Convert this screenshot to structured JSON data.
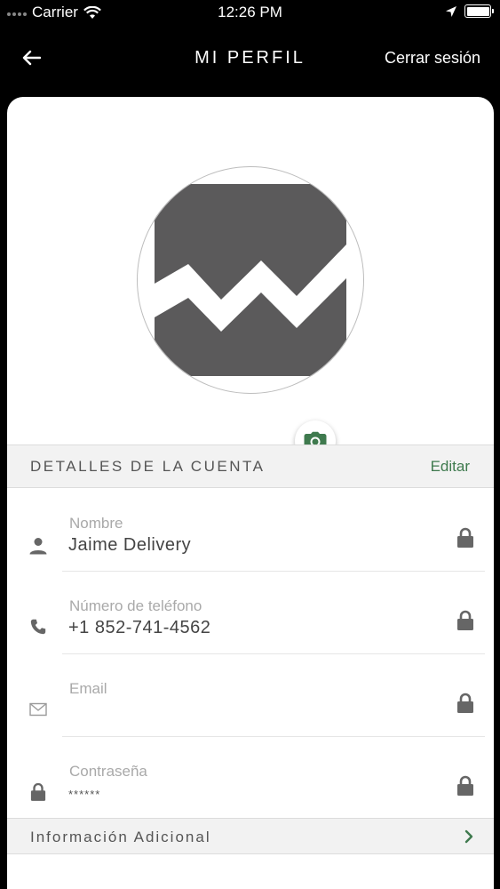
{
  "status": {
    "carrier": "Carrier",
    "time": "12:26 PM"
  },
  "nav": {
    "title": "MI PERFIL",
    "logout": "Cerrar sesión"
  },
  "account": {
    "section_title": "DETALLES DE LA CUENTA",
    "edit": "Editar",
    "fields": [
      {
        "label": "Nombre",
        "value": "Jaime Delivery",
        "icon": "person-icon"
      },
      {
        "label": "Número de teléfono",
        "value": "+1 852-741-4562",
        "icon": "phone-icon"
      },
      {
        "label": "Email",
        "value": "",
        "icon": "mail-icon"
      },
      {
        "label": "Contraseña",
        "value": "******",
        "icon": "lock-icon"
      }
    ]
  },
  "extra": {
    "section_title": "Información Adicional"
  },
  "colors": {
    "accent": "#3f7a4e",
    "icon_gray": "#666666",
    "avatar_gray": "#5b5a5b"
  }
}
